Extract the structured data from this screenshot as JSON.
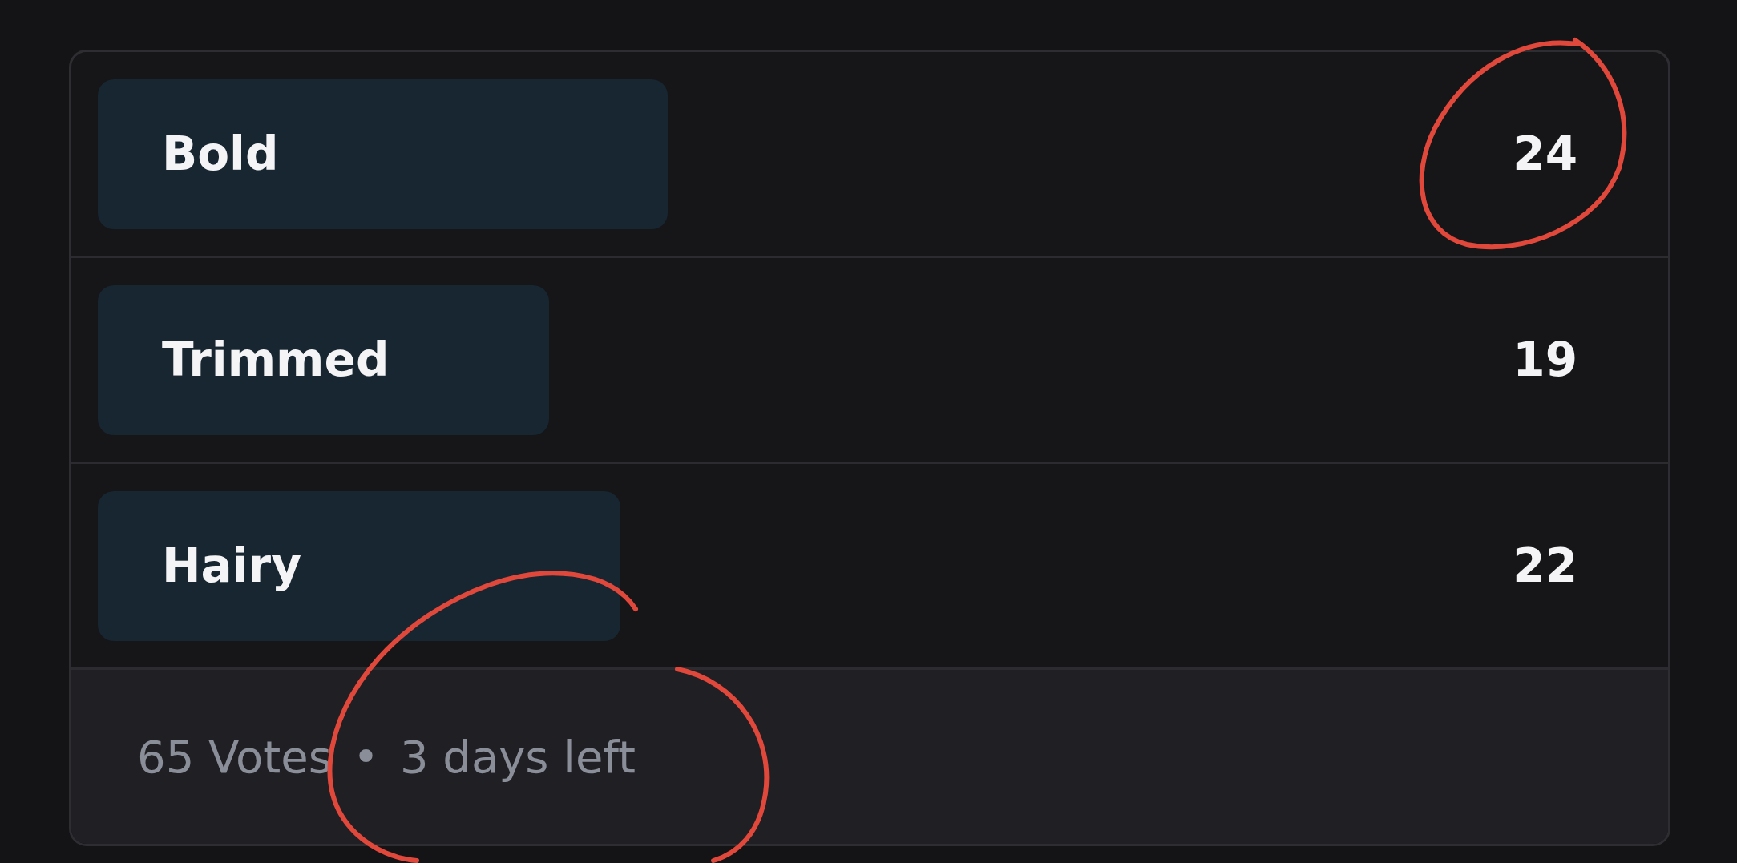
{
  "poll": {
    "options": [
      {
        "label": "Bold",
        "count": "24"
      },
      {
        "label": "Trimmed",
        "count": "19"
      },
      {
        "label": "Hairy",
        "count": "22"
      }
    ],
    "footer": {
      "votes": "65 Votes",
      "separator": "•",
      "time_left": "3 days left"
    }
  },
  "annotations": [
    {
      "kind": "circle",
      "color": "#e0483c"
    },
    {
      "kind": "circle",
      "color": "#e0483c"
    }
  ]
}
